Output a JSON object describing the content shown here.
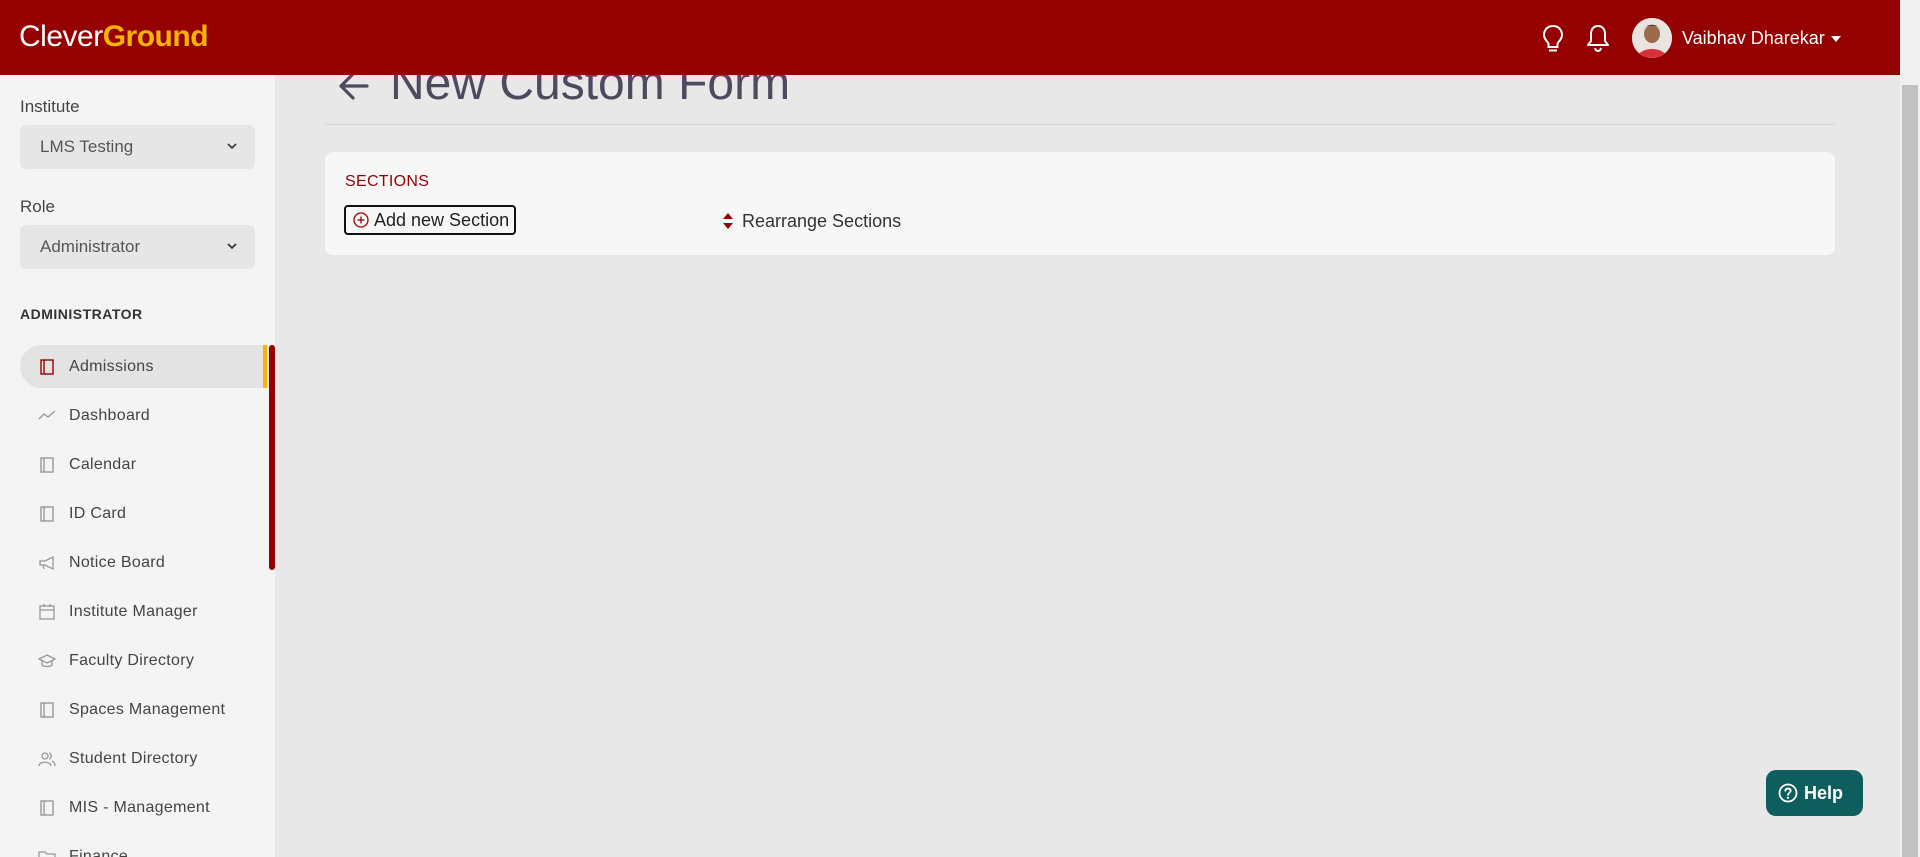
{
  "header": {
    "logo_part1": "Clever",
    "logo_part2": "Ground",
    "icons": [
      "lightbulb-icon",
      "bell-icon"
    ],
    "user_name": "Vaibhav Dharekar",
    "brand_color": "#950000",
    "accent_color": "#f7b500"
  },
  "sidebar": {
    "institute_label": "Institute",
    "institute_value": "LMS Testing",
    "role_label": "Role",
    "role_value": "Administrator",
    "section_heading": "ADMINISTRATOR",
    "items": [
      {
        "label": "Admissions",
        "icon": "book-icon",
        "active": true
      },
      {
        "label": "Dashboard",
        "icon": "chart-line-icon"
      },
      {
        "label": "Calendar",
        "icon": "book-icon"
      },
      {
        "label": "ID Card",
        "icon": "book-icon"
      },
      {
        "label": "Notice Board",
        "icon": "megaphone-icon"
      },
      {
        "label": "Institute Manager",
        "icon": "calendar-icon"
      },
      {
        "label": "Faculty Directory",
        "icon": "graduation-cap-icon"
      },
      {
        "label": "Spaces Management",
        "icon": "book-icon"
      },
      {
        "label": "Student Directory",
        "icon": "users-icon"
      },
      {
        "label": "MIS - Management",
        "icon": "book-icon"
      },
      {
        "label": "Finance",
        "icon": "folder-icon"
      }
    ]
  },
  "main": {
    "title": "New Custom Form",
    "sections_label": "SECTIONS",
    "add_section_label": "Add new Section",
    "rearrange_label": "Rearrange Sections"
  },
  "help": {
    "label": "Help",
    "color": "#0e5e5e"
  }
}
